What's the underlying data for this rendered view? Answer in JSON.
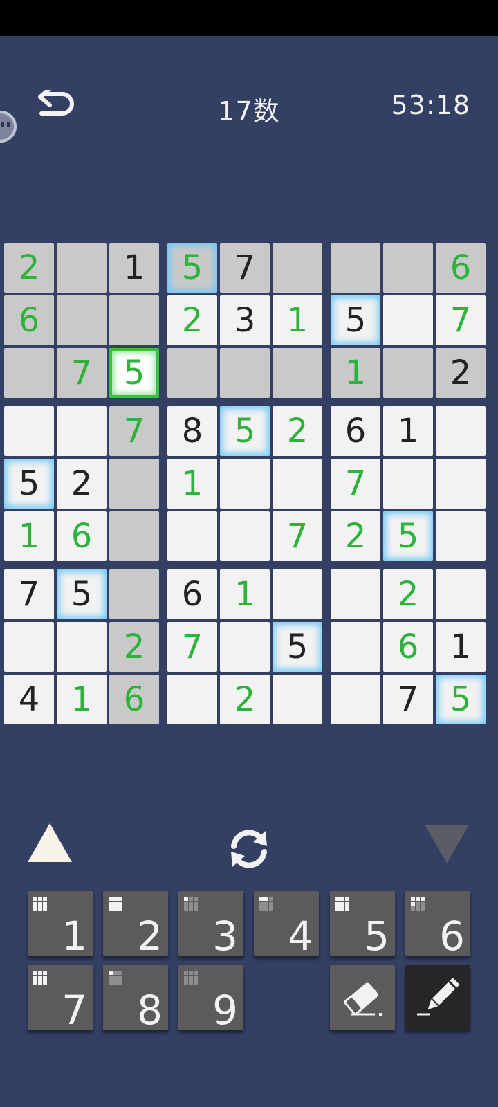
{
  "header": {
    "title": "17数",
    "timer": "53:18"
  },
  "board": {
    "rows": [
      [
        "2",
        "",
        "1",
        "5",
        "7",
        "",
        "",
        "",
        "6"
      ],
      [
        "6",
        "",
        "",
        "2",
        "3",
        "1",
        "5",
        "",
        "7"
      ],
      [
        "",
        "7",
        "5",
        "",
        "",
        "",
        "1",
        "",
        "2"
      ],
      [
        "",
        "",
        "7",
        "8",
        "5",
        "2",
        "6",
        "1",
        ""
      ],
      [
        "5",
        "2",
        "",
        "1",
        "",
        "",
        "7",
        "",
        ""
      ],
      [
        "1",
        "6",
        "",
        "",
        "",
        "7",
        "2",
        "5",
        ""
      ],
      [
        "7",
        "5",
        "",
        "6",
        "1",
        "",
        "",
        "2",
        ""
      ],
      [
        "",
        "",
        "2",
        "7",
        "",
        "5",
        "",
        "6",
        "1"
      ],
      [
        "4",
        "1",
        "6",
        "",
        "2",
        "",
        "",
        "7",
        "5"
      ]
    ],
    "types": [
      [
        "u",
        "",
        "g",
        "u",
        "g",
        "",
        "",
        "",
        "u"
      ],
      [
        "u",
        "",
        "",
        "u",
        "g",
        "u",
        "g",
        "",
        "u"
      ],
      [
        "",
        "u",
        "u",
        "",
        "",
        "",
        "u",
        "",
        "g"
      ],
      [
        "",
        "",
        "u",
        "g",
        "u",
        "u",
        "g",
        "g",
        ""
      ],
      [
        "g",
        "g",
        "",
        "u",
        "",
        "",
        "u",
        "",
        ""
      ],
      [
        "u",
        "u",
        "",
        "",
        "",
        "u",
        "u",
        "u",
        ""
      ],
      [
        "g",
        "g",
        "",
        "g",
        "u",
        "",
        "",
        "u",
        ""
      ],
      [
        "",
        "",
        "u",
        "u",
        "",
        "g",
        "",
        "u",
        "g"
      ],
      [
        "g",
        "u",
        "u",
        "",
        "u",
        "",
        "",
        "g",
        "u"
      ]
    ],
    "highlighted_cells": [
      [
        0,
        0
      ],
      [
        0,
        1
      ],
      [
        0,
        2
      ],
      [
        0,
        3
      ],
      [
        0,
        4
      ],
      [
        0,
        5
      ],
      [
        0,
        6
      ],
      [
        0,
        7
      ],
      [
        0,
        8
      ],
      [
        1,
        0
      ],
      [
        1,
        1
      ],
      [
        1,
        2
      ],
      [
        2,
        0
      ],
      [
        2,
        1
      ],
      [
        2,
        2
      ],
      [
        2,
        3
      ],
      [
        2,
        4
      ],
      [
        2,
        5
      ],
      [
        2,
        6
      ],
      [
        2,
        7
      ],
      [
        2,
        8
      ],
      [
        3,
        2
      ],
      [
        4,
        2
      ],
      [
        5,
        2
      ],
      [
        6,
        2
      ],
      [
        7,
        2
      ],
      [
        8,
        2
      ]
    ],
    "glow_cells": [
      [
        0,
        3
      ],
      [
        1,
        6
      ],
      [
        3,
        4
      ],
      [
        4,
        0
      ],
      [
        5,
        7
      ],
      [
        6,
        1
      ],
      [
        7,
        5
      ],
      [
        8,
        8
      ]
    ],
    "selected_cell": [
      2,
      2
    ],
    "colors": {
      "user": "#2db33c",
      "given": "#222222",
      "glow": "#6ec8f5",
      "selected": "#34c240"
    }
  },
  "controls": {
    "prev_icon": "triangle-up-icon",
    "refresh_icon": "refresh-icon",
    "next_icon": "triangle-down-icon"
  },
  "keypad": {
    "keys": [
      {
        "label": "1",
        "dots": 9
      },
      {
        "label": "2",
        "dots": 9
      },
      {
        "label": "3",
        "dots": 1
      },
      {
        "label": "4",
        "dots": 2
      },
      {
        "label": "5",
        "dots": 9
      },
      {
        "label": "6",
        "dots": 4
      },
      {
        "label": "7",
        "dots": 9
      },
      {
        "label": "8",
        "dots": 1
      },
      {
        "label": "9",
        "dots": 0
      }
    ],
    "eraser_icon": "eraser-icon",
    "pencil_icon": "pencil-icon"
  }
}
